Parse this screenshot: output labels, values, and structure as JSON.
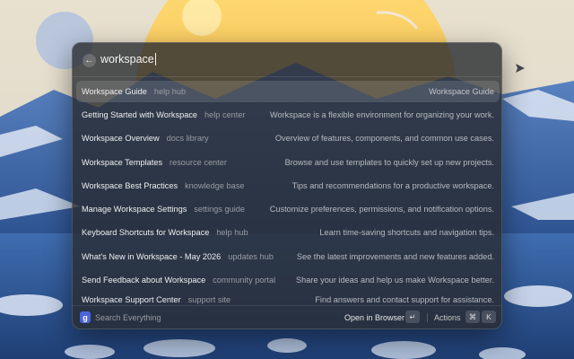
{
  "search": {
    "back_glyph": "←",
    "query": "workspace"
  },
  "results": [
    {
      "title": "Workspace Guide",
      "source": "help hub",
      "description": "Workspace Guide",
      "selected": true
    },
    {
      "title": "Getting Started with Workspace",
      "source": "help center",
      "description": "Workspace is a flexible environment for organizing your work."
    },
    {
      "title": "Workspace Overview",
      "source": "docs library",
      "description": "Overview of features, components, and common use cases."
    },
    {
      "title": "Workspace Templates",
      "source": "resource center",
      "description": "Browse and use templates to quickly set up new projects."
    },
    {
      "title": "Workspace Best Practices",
      "source": "knowledge base",
      "description": "Tips and recommendations for a productive workspace."
    },
    {
      "title": "Manage Workspace Settings",
      "source": "settings guide",
      "description": "Customize preferences, permissions, and notification options."
    },
    {
      "title": "Keyboard Shortcuts for Workspace",
      "source": "help hub",
      "description": "Learn time-saving shortcuts and navigation tips."
    },
    {
      "title": "What's New in Workspace - May 2026",
      "source": "updates hub",
      "description": "See the latest improvements and new features added."
    },
    {
      "title": "Send Feedback about Workspace",
      "source": "community portal",
      "description": "Share your ideas and help us make Workspace better."
    },
    {
      "title": "Workspace Support Center",
      "source": "support site",
      "description": "Find answers and contact support for assistance."
    }
  ],
  "footer": {
    "logo_glyph": "g",
    "search_placeholder": "Search Everything",
    "open_label": "Open in Browser",
    "enter_key": "↵",
    "actions_label": "Actions",
    "cmd_key": "⌘",
    "k_key": "K"
  },
  "colors": {
    "accent": "#4c63e0",
    "panel_bg": "#2a2c32"
  }
}
